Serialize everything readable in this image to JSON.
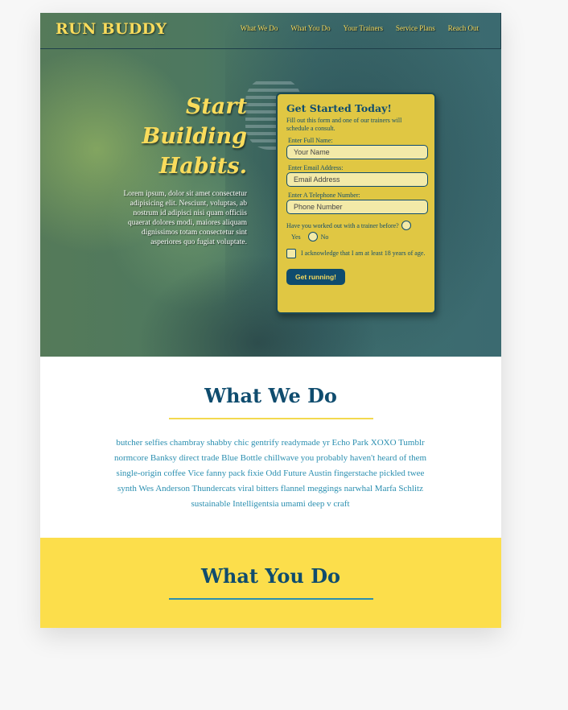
{
  "header": {
    "logo": "RUN BUDDY",
    "nav": [
      "What We Do",
      "What You Do",
      "Your Trainers",
      "Service Plans",
      "Reach Out"
    ]
  },
  "hero": {
    "title_lines": [
      "Start",
      "Building",
      "Habits."
    ],
    "body": "Lorem ipsum, dolor sit amet consectetur adipisicing elit. Nesciunt, voluptas, ab nostrum id adipisci nisi quam officiis quaerat dolores modi, maiores aliquam dignissimos totam consectetur sint asperiores quo fugiat voluptate."
  },
  "form": {
    "title": "Get Started Today!",
    "subtitle": "Fill out this form and one of our trainers will schedule a consult.",
    "name_label": "Enter Full Name:",
    "name_placeholder": "Your Name",
    "email_label": "Enter Email Address:",
    "email_placeholder": "Email Address",
    "phone_label": "Enter A Telephone Number:",
    "phone_placeholder": "Phone Number",
    "worked_out_question": "Have you worked out with a trainer before?",
    "yes_label": "Yes",
    "no_label": "No",
    "age_ack": "I acknowledge that I am at least 18 years of age.",
    "submit": "Get running!"
  },
  "what_we_do": {
    "title": "What We Do",
    "body": "butcher selfies chambray shabby chic gentrify readymade yr Echo Park XOXO Tumblr normcore Banksy direct trade Blue Bottle chillwave you probably haven't heard of them single-origin coffee Vice fanny pack fixie Odd Future Austin fingerstache pickled twee synth Wes Anderson Thundercats viral bitters flannel meggings narwhal Marfa Schlitz sustainable Intelligentsia umami deep v craft"
  },
  "what_you_do": {
    "title": "What You Do"
  },
  "colors": {
    "brand_yellow": "#f9dc5c",
    "brand_blue": "#0f4c6e",
    "accent_teal": "#2b8fb0"
  }
}
